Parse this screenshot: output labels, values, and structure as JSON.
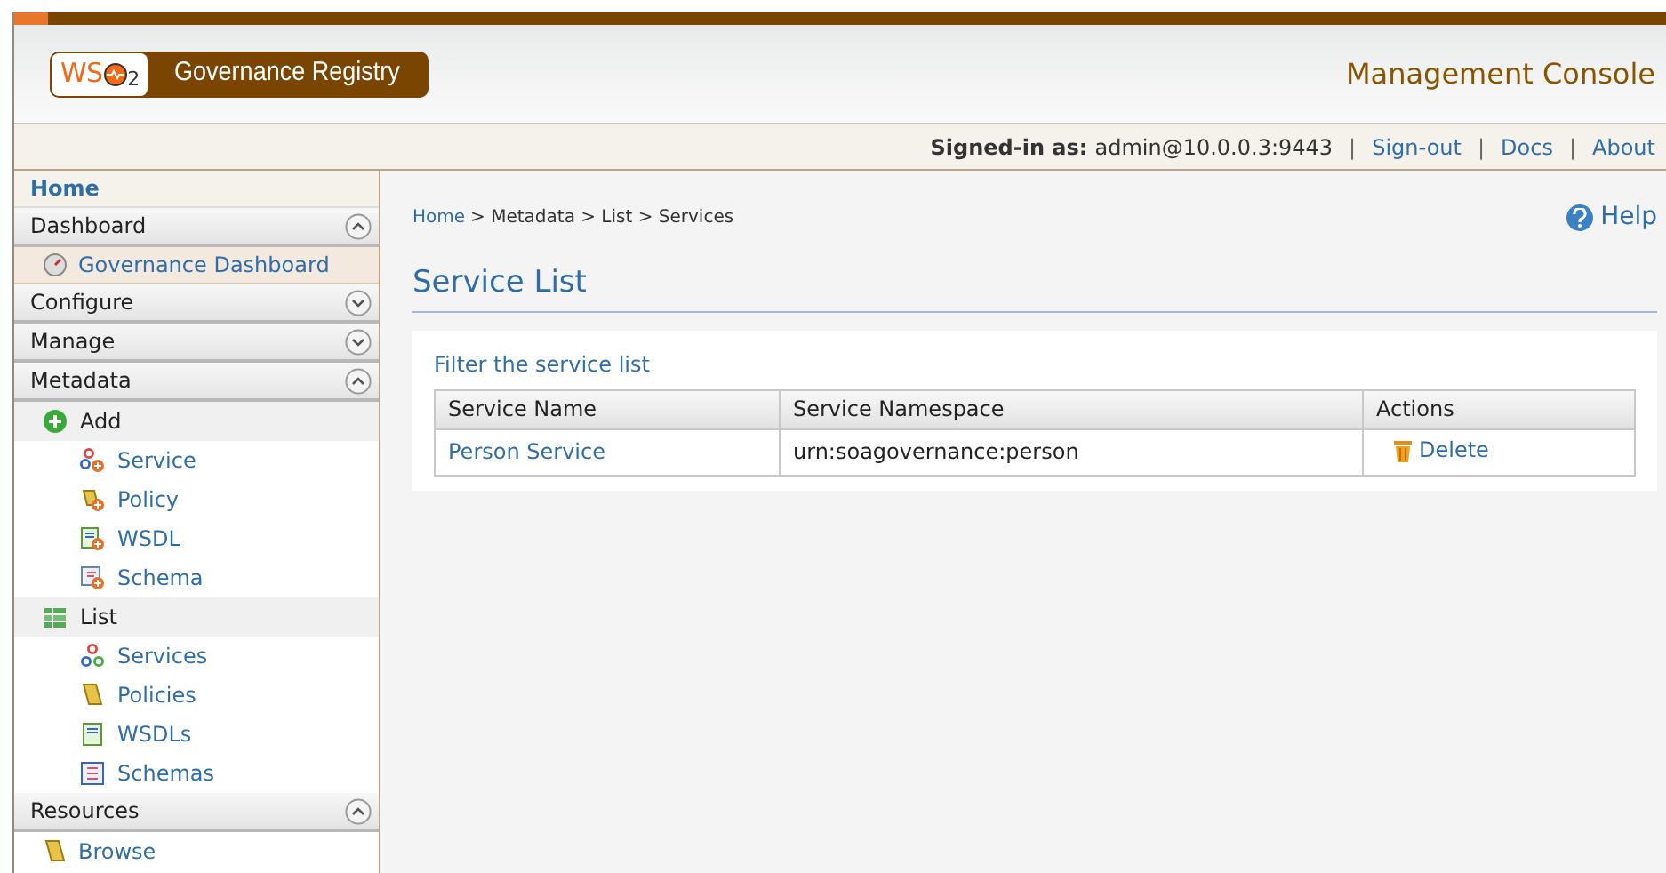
{
  "header": {
    "logo_mark": "WS",
    "logo_sub": "2",
    "product": "Governance Registry",
    "title": "Management Console"
  },
  "user_bar": {
    "label": "Signed-in as:",
    "user": "admin@10.0.0.3:9443",
    "separator": "|",
    "links": [
      "Sign-out",
      "Docs",
      "About"
    ]
  },
  "sidebar": {
    "items": [
      {
        "kind": "home",
        "label": "Home"
      },
      {
        "kind": "section",
        "label": "Dashboard",
        "expanded": true
      },
      {
        "kind": "link",
        "label": "Governance Dashboard",
        "highlight": true
      },
      {
        "kind": "section",
        "label": "Configure",
        "expanded": false
      },
      {
        "kind": "section",
        "label": "Manage",
        "expanded": false
      },
      {
        "kind": "section",
        "label": "Metadata",
        "expanded": true
      },
      {
        "kind": "group",
        "label": "Add"
      },
      {
        "kind": "sublink",
        "label": "Service"
      },
      {
        "kind": "sublink",
        "label": "Policy"
      },
      {
        "kind": "sublink",
        "label": "WSDL"
      },
      {
        "kind": "sublink",
        "label": "Schema"
      },
      {
        "kind": "group",
        "label": "List"
      },
      {
        "kind": "sublink",
        "label": "Services"
      },
      {
        "kind": "sublink",
        "label": "Policies"
      },
      {
        "kind": "sublink",
        "label": "WSDLs"
      },
      {
        "kind": "sublink",
        "label": "Schemas"
      },
      {
        "kind": "section",
        "label": "Resources",
        "expanded": true
      },
      {
        "kind": "link",
        "label": "Browse",
        "highlight": false
      }
    ]
  },
  "breadcrumb": {
    "link": "Home",
    "rest": "> Metadata > List > Services"
  },
  "help": "Help",
  "page_title": "Service List",
  "filter_link": "Filter the service list",
  "table": {
    "columns": [
      "Service Name",
      "Service Namespace",
      "Actions"
    ],
    "rows": [
      {
        "name": "Person Service",
        "namespace": "urn:soagovernance:person",
        "action": "Delete"
      }
    ]
  }
}
